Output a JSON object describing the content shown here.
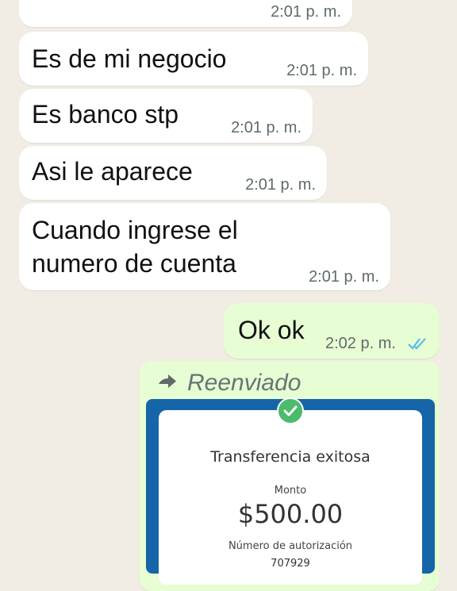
{
  "messages": [
    {
      "text": "",
      "time": "2:01 p. m."
    },
    {
      "text": "Es de mi negocio",
      "time": "2:01 p. m."
    },
    {
      "text": "Es banco stp",
      "time": "2:01 p. m."
    },
    {
      "text": "Asi le aparece",
      "time": "2:01 p. m."
    },
    {
      "text_line1": "Cuando ingrese el",
      "text_line2": "numero de cuenta",
      "time": "2:01 p. m."
    },
    {
      "text": "Ok ok",
      "time": "2:02 p. m.",
      "status": "read"
    }
  ],
  "forwarded": {
    "label": "Reenviado",
    "icon": "forward-arrow-icon",
    "receipt": {
      "title": "Transferencia exitosa",
      "amount_label": "Monto",
      "amount": "$500.00",
      "auth_label": "Número de autorización",
      "auth_number": "707929",
      "frame_color": "#1565a8",
      "check_color": "#4cbb6c"
    }
  },
  "colors": {
    "background": "#f1ece4",
    "incoming_bubble": "#ffffff",
    "outgoing_bubble": "#e7fdd3",
    "read_ticks": "#4fb6ec"
  }
}
